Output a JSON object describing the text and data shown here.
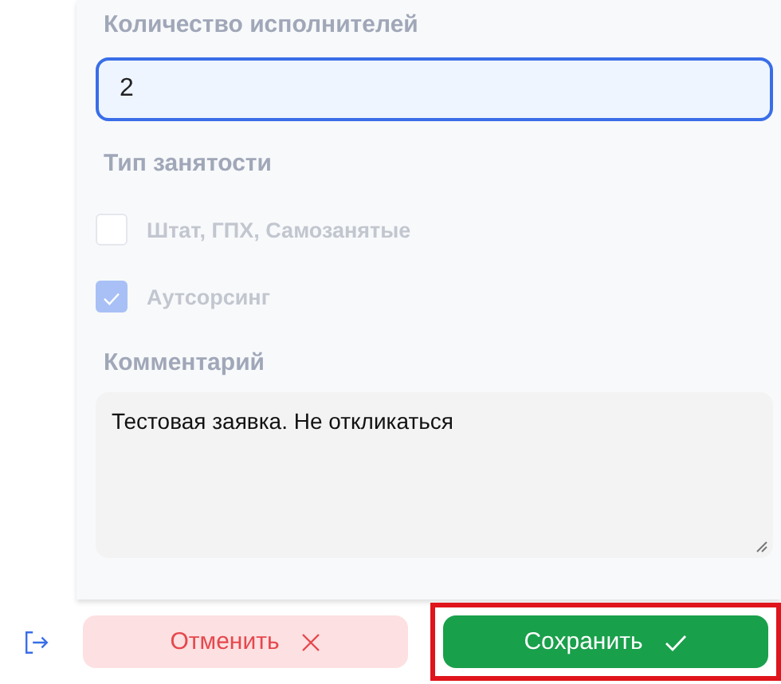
{
  "performers": {
    "label": "Количество исполнителей",
    "value": "2",
    "focused": true
  },
  "employment": {
    "label": "Тип занятости",
    "options": [
      {
        "label": "Штат, ГПХ, Самозанятые",
        "checked": false,
        "disabled": true
      },
      {
        "label": "Аутсорсинг",
        "checked": true,
        "disabled": true
      }
    ]
  },
  "comment": {
    "label": "Комментарий",
    "value": "Тестовая заявка. Не откликаться"
  },
  "buttons": [
    {
      "kind": "cancel",
      "label": "Отменить",
      "highlighted": false
    },
    {
      "kind": "save",
      "label": "Сохранить",
      "highlighted": true
    }
  ]
}
